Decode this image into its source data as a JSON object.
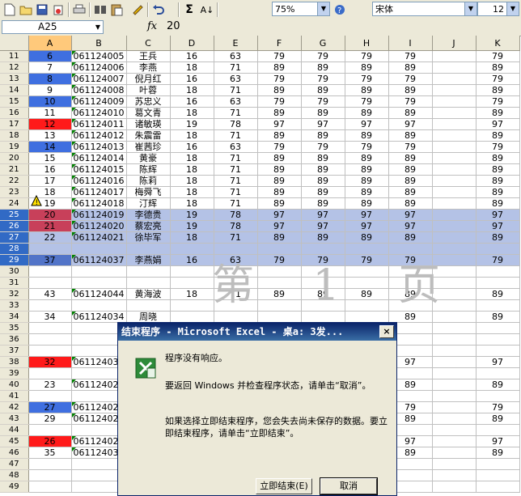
{
  "toolbar": {
    "zoom": "75%",
    "font_name": "宋体",
    "font_size": "12",
    "icons": [
      "new-icon",
      "open-icon",
      "save-icon",
      "permission-icon",
      "print-icon",
      "research-icon",
      "paste-icon",
      "format-painter-icon",
      "undo-icon",
      "autosum-icon",
      "sort-icon",
      "zoom-icon",
      "help-icon"
    ]
  },
  "formula_bar": {
    "cell_ref": "A25",
    "fx": "fx",
    "value": "20"
  },
  "columns": [
    "A",
    "B",
    "C",
    "D",
    "E",
    "F",
    "G",
    "H",
    "I",
    "J",
    "K"
  ],
  "rows": [
    {
      "n": "11",
      "A": "6",
      "B": "061124005",
      "C": "王兵",
      "D": "16",
      "E": "63",
      "F": "79",
      "G": "79",
      "H": "79",
      "I": "79",
      "J": "",
      "K": "79",
      "a": "blue"
    },
    {
      "n": "12",
      "A": "7",
      "B": "061124006",
      "C": "李燕",
      "D": "18",
      "E": "71",
      "F": "89",
      "G": "89",
      "H": "89",
      "I": "89",
      "J": "",
      "K": "89"
    },
    {
      "n": "13",
      "A": "8",
      "B": "061124007",
      "C": "倪月红",
      "D": "16",
      "E": "63",
      "F": "79",
      "G": "79",
      "H": "79",
      "I": "79",
      "J": "",
      "K": "79",
      "a": "blue"
    },
    {
      "n": "14",
      "A": "9",
      "B": "061124008",
      "C": "叶蓉",
      "D": "18",
      "E": "71",
      "F": "89",
      "G": "89",
      "H": "89",
      "I": "89",
      "J": "",
      "K": "89"
    },
    {
      "n": "15",
      "A": "10",
      "B": "061124009",
      "C": "苏忠义",
      "D": "16",
      "E": "63",
      "F": "79",
      "G": "79",
      "H": "79",
      "I": "79",
      "J": "",
      "K": "79",
      "a": "blue"
    },
    {
      "n": "16",
      "A": "11",
      "B": "061124010",
      "C": "葛文青",
      "D": "18",
      "E": "71",
      "F": "89",
      "G": "89",
      "H": "89",
      "I": "89",
      "J": "",
      "K": "89"
    },
    {
      "n": "17",
      "A": "12",
      "B": "061124011",
      "C": "诸敏瑛",
      "D": "19",
      "E": "78",
      "F": "97",
      "G": "97",
      "H": "97",
      "I": "97",
      "J": "",
      "K": "97",
      "a": "red"
    },
    {
      "n": "18",
      "A": "13",
      "B": "061124012",
      "C": "朱震雷",
      "D": "18",
      "E": "71",
      "F": "89",
      "G": "89",
      "H": "89",
      "I": "89",
      "J": "",
      "K": "89"
    },
    {
      "n": "19",
      "A": "14",
      "B": "061124013",
      "C": "崔茜珍",
      "D": "16",
      "E": "63",
      "F": "79",
      "G": "79",
      "H": "79",
      "I": "79",
      "J": "",
      "K": "79",
      "a": "blue"
    },
    {
      "n": "20",
      "A": "15",
      "B": "061124014",
      "C": "黄豪",
      "D": "18",
      "E": "71",
      "F": "89",
      "G": "89",
      "H": "89",
      "I": "89",
      "J": "",
      "K": "89"
    },
    {
      "n": "21",
      "A": "16",
      "B": "061124015",
      "C": "陈辉",
      "D": "18",
      "E": "71",
      "F": "89",
      "G": "89",
      "H": "89",
      "I": "89",
      "J": "",
      "K": "89"
    },
    {
      "n": "22",
      "A": "17",
      "B": "061124016",
      "C": "陈莉",
      "D": "18",
      "E": "71",
      "F": "89",
      "G": "89",
      "H": "89",
      "I": "89",
      "J": "",
      "K": "89"
    },
    {
      "n": "23",
      "A": "18",
      "B": "061124017",
      "C": "梅舜飞",
      "D": "18",
      "E": "71",
      "F": "89",
      "G": "89",
      "H": "89",
      "I": "89",
      "J": "",
      "K": "89"
    },
    {
      "n": "24",
      "A": "19",
      "B": "061124018",
      "C": "汀辉",
      "D": "18",
      "E": "71",
      "F": "89",
      "G": "89",
      "H": "89",
      "I": "89",
      "J": "",
      "K": "89"
    },
    {
      "n": "25",
      "A": "20",
      "B": "061124019",
      "C": "李德贵",
      "D": "19",
      "E": "78",
      "F": "97",
      "G": "97",
      "H": "97",
      "I": "97",
      "J": "",
      "K": "97",
      "a": "red",
      "sel": true
    },
    {
      "n": "26",
      "A": "21",
      "B": "061124020",
      "C": "蔡宏亮",
      "D": "19",
      "E": "78",
      "F": "97",
      "G": "97",
      "H": "97",
      "I": "97",
      "J": "",
      "K": "97",
      "a": "red",
      "sel": true
    },
    {
      "n": "27",
      "A": "22",
      "B": "061124021",
      "C": "徐毕军",
      "D": "18",
      "E": "71",
      "F": "89",
      "G": "89",
      "H": "89",
      "I": "89",
      "J": "",
      "K": "89",
      "sel": true
    },
    {
      "n": "28",
      "A": "",
      "B": "",
      "C": "",
      "D": "",
      "E": "",
      "F": "",
      "G": "",
      "H": "",
      "I": "",
      "J": "",
      "K": "",
      "sel": true
    },
    {
      "n": "29",
      "A": "37",
      "B": "061124037",
      "C": "李燕娟",
      "D": "16",
      "E": "63",
      "F": "79",
      "G": "79",
      "H": "79",
      "I": "79",
      "J": "",
      "K": "79",
      "a": "blue",
      "sel": true
    },
    {
      "n": "30",
      "A": "",
      "B": "",
      "C": "",
      "D": "",
      "E": "",
      "F": "",
      "G": "",
      "H": "",
      "I": "",
      "J": "",
      "K": ""
    },
    {
      "n": "31",
      "A": "",
      "B": "",
      "C": "",
      "D": "",
      "E": "",
      "F": "",
      "G": "",
      "H": "",
      "I": "",
      "J": "",
      "K": ""
    },
    {
      "n": "32",
      "A": "43",
      "B": "061124044",
      "C": "黄海波",
      "D": "18",
      "E": "71",
      "F": "89",
      "G": "89",
      "H": "89",
      "I": "89",
      "J": "",
      "K": "89"
    },
    {
      "n": "33",
      "A": "",
      "B": "",
      "C": "",
      "D": "",
      "E": "",
      "F": "",
      "G": "",
      "H": "",
      "I": "",
      "J": "",
      "K": ""
    },
    {
      "n": "34",
      "A": "34",
      "B": "061124034",
      "C": "周晓",
      "D": "",
      "E": "",
      "F": "",
      "G": "",
      "H": "",
      "I": "89",
      "J": "",
      "K": "89"
    },
    {
      "n": "35",
      "A": "",
      "B": "",
      "C": "",
      "D": "",
      "E": "",
      "F": "",
      "G": "",
      "H": "",
      "I": "",
      "J": "",
      "K": ""
    },
    {
      "n": "36",
      "A": "",
      "B": "",
      "C": "",
      "D": "",
      "E": "",
      "F": "",
      "G": "",
      "H": "",
      "I": "",
      "J": "",
      "K": ""
    },
    {
      "n": "37",
      "A": "",
      "B": "",
      "C": "",
      "D": "",
      "E": "",
      "F": "",
      "G": "",
      "H": "",
      "I": "",
      "J": "",
      "K": ""
    },
    {
      "n": "38",
      "A": "32",
      "B": "061124032",
      "C": "",
      "D": "",
      "E": "",
      "F": "",
      "G": "",
      "H": "",
      "I": "97",
      "J": "",
      "K": "97",
      "a": "red"
    },
    {
      "n": "39",
      "A": "",
      "B": "",
      "C": "",
      "D": "",
      "E": "",
      "F": "",
      "G": "",
      "H": "",
      "I": "",
      "J": "",
      "K": ""
    },
    {
      "n": "40",
      "A": "23",
      "B": "061124022",
      "C": "",
      "D": "",
      "E": "",
      "F": "",
      "G": "",
      "H": "",
      "I": "89",
      "J": "",
      "K": "89"
    },
    {
      "n": "41",
      "A": "",
      "B": "",
      "C": "",
      "D": "",
      "E": "",
      "F": "",
      "G": "",
      "H": "",
      "I": "",
      "J": "",
      "K": ""
    },
    {
      "n": "42",
      "A": "27",
      "B": "061124026",
      "C": "",
      "D": "",
      "E": "",
      "F": "",
      "G": "",
      "H": "",
      "I": "79",
      "J": "",
      "K": "79",
      "a": "blue"
    },
    {
      "n": "43",
      "A": "29",
      "B": "061124028",
      "C": "",
      "D": "",
      "E": "",
      "F": "",
      "G": "",
      "H": "",
      "I": "89",
      "J": "",
      "K": "89"
    },
    {
      "n": "44",
      "A": "",
      "B": "",
      "C": "",
      "D": "",
      "E": "",
      "F": "",
      "G": "",
      "H": "",
      "I": "",
      "J": "",
      "K": ""
    },
    {
      "n": "45",
      "A": "26",
      "B": "061124025",
      "C": "",
      "D": "",
      "E": "",
      "F": "",
      "G": "",
      "H": "",
      "I": "97",
      "J": "",
      "K": "97",
      "a": "red"
    },
    {
      "n": "46",
      "A": "35",
      "B": "061124035",
      "C": "",
      "D": "",
      "E": "",
      "F": "",
      "G": "",
      "H": "",
      "I": "89",
      "J": "",
      "K": "89"
    },
    {
      "n": "47",
      "A": "",
      "B": "",
      "C": "",
      "D": "",
      "E": "",
      "F": "",
      "G": "",
      "H": "",
      "I": "",
      "J": "",
      "K": ""
    },
    {
      "n": "48",
      "A": "",
      "B": "",
      "C": "",
      "D": "",
      "E": "",
      "F": "",
      "G": "",
      "H": "",
      "I": "",
      "J": "",
      "K": ""
    },
    {
      "n": "49",
      "A": "",
      "B": "",
      "C": "",
      "D": "",
      "E": "",
      "F": "",
      "G": "",
      "H": "",
      "I": "",
      "J": "",
      "K": ""
    }
  ],
  "watermark": "第 1 页",
  "dialog": {
    "title": "结束程序 - Microsoft Excel - 桌a: 3发...",
    "close": "×",
    "line1": "程序没有响应。",
    "line2": "要返回 Windows 并检查程序状态，请单击“取消”。",
    "line3": "如果选择立即结束程序，您会失去尚未保存的数据。要立即结束程序，请单击“立即结束”。",
    "end_now": "立即结束(E)",
    "cancel": "取消"
  }
}
